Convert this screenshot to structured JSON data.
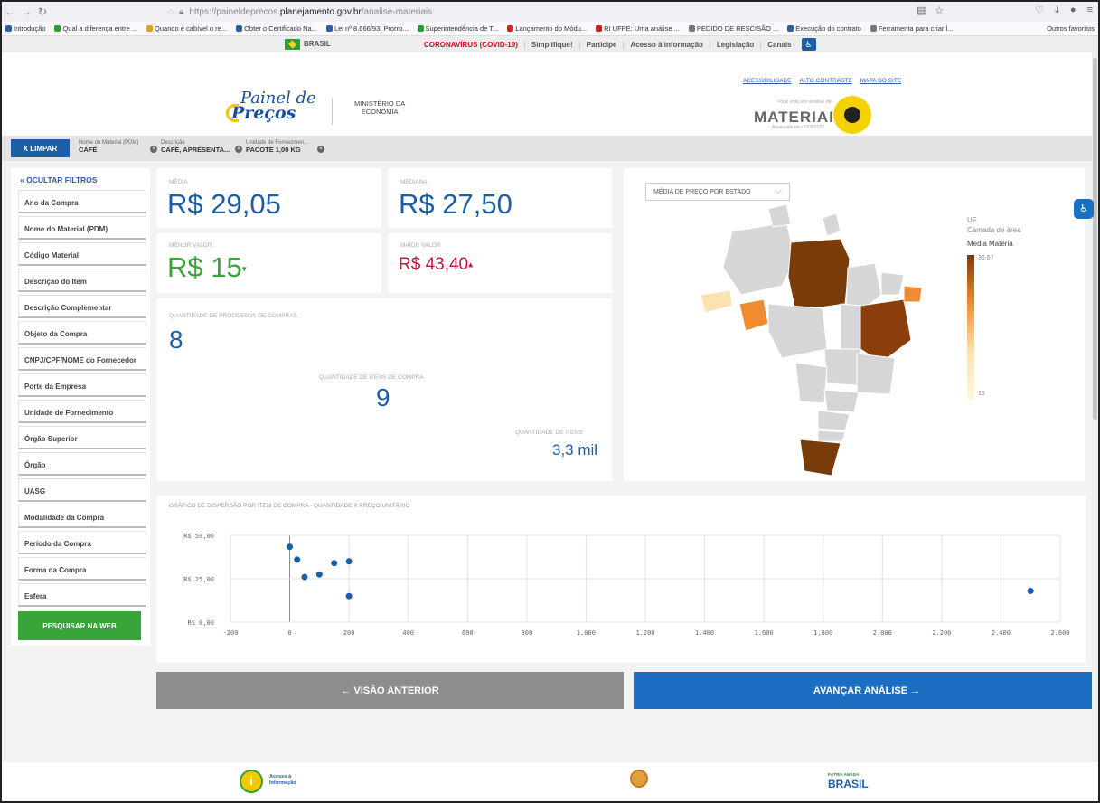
{
  "browser": {
    "url_prefix": "https://paineldeprecos.",
    "url_domain": "planejamento.gov.br",
    "url_path": "/analise-materiais",
    "bookmarks": [
      {
        "label": "Introdução",
        "color": "#2b5ea8"
      },
      {
        "label": "Qual a diferença entre ...",
        "color": "#2a9d3a"
      },
      {
        "label": "Quando é cabível o re...",
        "color": "#e0a020"
      },
      {
        "label": "Obter o Certificado Na...",
        "color": "#2b5ea8"
      },
      {
        "label": "Lei nº 8.666/93. Prorro...",
        "color": "#2b5ea8"
      },
      {
        "label": "Superintendência de T...",
        "color": "#2a9d3a"
      },
      {
        "label": "Lançamento do Módu...",
        "color": "#d02020"
      },
      {
        "label": "RI UFPE: Uma análise ...",
        "color": "#c02020"
      },
      {
        "label": "PEDIDO DE RESCISÃO ...",
        "color": "#777"
      },
      {
        "label": "Execução do contrato",
        "color": "#2b5ea8"
      },
      {
        "label": "Ferramenta para criar l...",
        "color": "#777"
      }
    ],
    "other_favorites": "Outros favoritos"
  },
  "govbar": {
    "brasil": "BRASIL",
    "links": [
      "CORONAVÍRUS (COVID-19)",
      "Simplifique!",
      "Participe",
      "Acesso à informação",
      "Legislação",
      "Canais"
    ]
  },
  "header": {
    "logo_line1": "Painel de",
    "logo_line2": "Preços",
    "ministry_line1": "MINISTÉRIO DA",
    "ministry_line2": "ECONOMIA",
    "toplinks": [
      "ACESSIBILIDADE",
      "ALTO CONTRASTE",
      "MAPA DO SITE"
    ],
    "mat_note": "Você está em análise de",
    "mat_title": "MATERIAIS",
    "mat_date": "Atualizado em 09/05/2022"
  },
  "filterbar": {
    "clear": "X  LIMPAR",
    "chips": [
      {
        "label": "Nome do Material (PDM)",
        "value": "CAFÉ"
      },
      {
        "label": "Descrição",
        "value": "CAFÉ, APRESENTA..."
      },
      {
        "label": "Unidade de Fornecimen...",
        "value": "PACOTE 1,00 KG"
      }
    ]
  },
  "sidebar": {
    "hide": "« OCULTAR FILTROS",
    "filters": [
      "Ano da Compra",
      "Nome do Material (PDM)",
      "Código Material",
      "Descrição do Item",
      "Descrição Complementar",
      "Objeto da Compra",
      "CNPJ/CPF/NOME do Fornecedor",
      "Porte da Empresa",
      "Unidade de Fornecimento",
      "Órgão Superior",
      "Órgão",
      "UASG",
      "Modalidade da Compra",
      "Período da Compra",
      "Forma da Compra",
      "Esfera"
    ],
    "search_web": "PESQUISAR NA WEB"
  },
  "stats": {
    "media_label": "MÉDIA",
    "media": "R$ 29,05",
    "mediana_label": "MEDIANA",
    "mediana": "R$ 27,50",
    "menor_label": "MENOR VALOR",
    "menor": "R$ 15",
    "maior_label": "MAIOR VALOR",
    "maior": "R$ 43,40",
    "proc_label": "QUANTIDADE DE PROCESSOS DE COMPRAS",
    "proc": "8",
    "itens_label": "QUANTIDADE DE ITENS DE COMPRA",
    "itens": "9",
    "qtd_label": "QUANTIDADE DE ITENS",
    "qtd": "3,3 mil"
  },
  "map": {
    "dropdown": "MÉDIA DE PREÇO POR ESTADO",
    "legend_uf": "UF",
    "legend_layer": "Camada de área",
    "legend_title": "Média Materia",
    "legend_max": "36,67",
    "legend_min": "15"
  },
  "chart_data": {
    "type": "scatter",
    "title": "GRÁFICO DE DISPERSÃO POR ITEM DE COMPRA - QUANTIDADE X PREÇO UNITÁRIO",
    "xlim": [
      -200,
      2600
    ],
    "ylim": [
      0,
      50
    ],
    "xticks": [
      "-200",
      "0",
      "200",
      "400",
      "600",
      "800",
      "1.000",
      "1.200",
      "1.400",
      "1.600",
      "1.800",
      "2.000",
      "2.200",
      "2.400",
      "2.600"
    ],
    "yticks": [
      "R$ 0,00",
      "R$ 25,00",
      "R$ 50,00"
    ],
    "points": [
      {
        "x": 0,
        "y": 43.4
      },
      {
        "x": 25,
        "y": 36
      },
      {
        "x": 50,
        "y": 26
      },
      {
        "x": 100,
        "y": 27.5
      },
      {
        "x": 150,
        "y": 34
      },
      {
        "x": 200,
        "y": 35
      },
      {
        "x": 200,
        "y": 15
      },
      {
        "x": 2500,
        "y": 18
      }
    ],
    "color": "#1b5ea6"
  },
  "nav": {
    "prev": "←  VISÃO ANTERIOR",
    "next": "AVANÇAR ANÁLISE  →"
  },
  "footer": {
    "info_line1": "Acesso à",
    "info_line2": "Informação",
    "brasil_small": "PÁTRIA AMADA",
    "brasil": "BRASIL"
  }
}
